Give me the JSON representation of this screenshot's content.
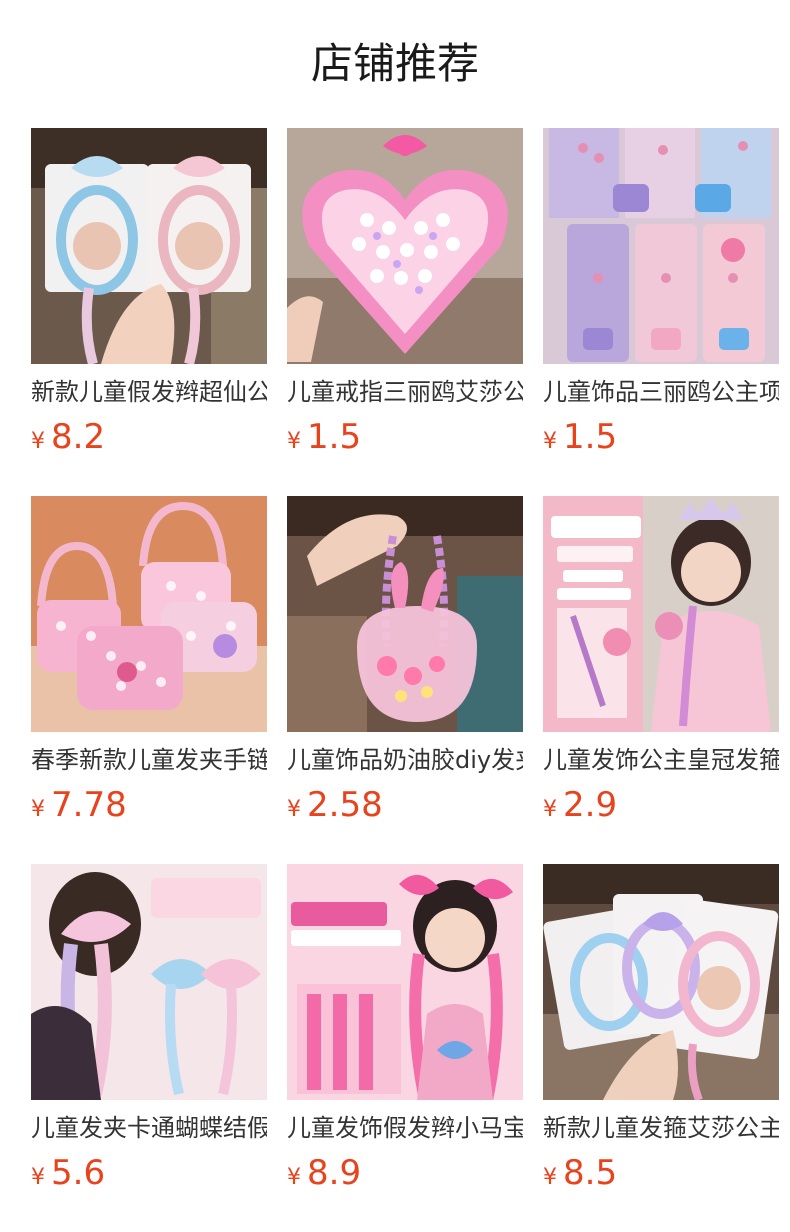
{
  "header": {
    "title": "店铺推荐"
  },
  "products": [
    {
      "name": "新款儿童假发辫超仙公主",
      "currency": "¥",
      "price": "8.2",
      "image": "hairband-product-photo"
    },
    {
      "name": "儿童戒指三丽鸥艾莎公主",
      "currency": "¥",
      "price": "1.5",
      "image": "ring-set-product-photo"
    },
    {
      "name": "儿童饰品三丽鸥公主项链",
      "currency": "¥",
      "price": "1.5",
      "image": "necklace-product-photo"
    },
    {
      "name": "春季新款儿童发夹手链套装",
      "currency": "¥",
      "price": "7.78",
      "image": "jewelry-box-product-photo"
    },
    {
      "name": "儿童饰品奶油胶diy发夹包",
      "currency": "¥",
      "price": "2.58",
      "image": "bag-product-photo"
    },
    {
      "name": "儿童发饰公主皇冠发箍魔法",
      "currency": "¥",
      "price": "2.9",
      "image": "crown-product-photo"
    },
    {
      "name": "儿童发夹卡通蝴蝶结假发辫",
      "currency": "¥",
      "price": "5.6",
      "image": "bow-clip-product-photo"
    },
    {
      "name": "儿童发饰假发辫小马宝莉",
      "currency": "¥",
      "price": "8.9",
      "image": "pony-clip-product-photo"
    },
    {
      "name": "新款儿童发箍艾莎公主假发",
      "currency": "¥",
      "price": "8.5",
      "image": "headband-product-photo"
    }
  ],
  "palette": {
    "price": "#e8431c",
    "title": "#1a1a1a",
    "name": "#333333"
  }
}
